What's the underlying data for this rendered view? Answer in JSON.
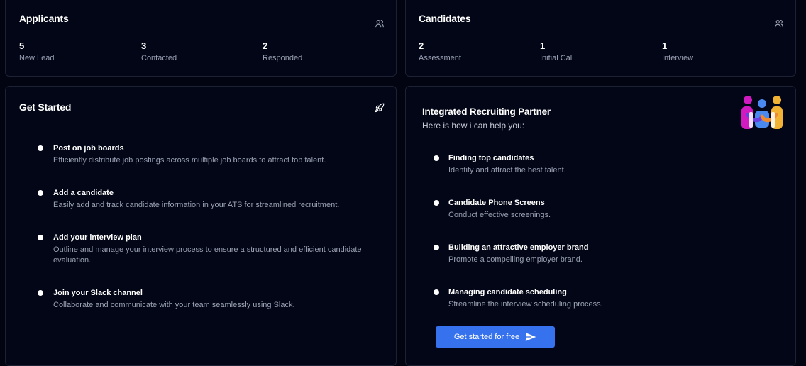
{
  "applicants": {
    "title": "Applicants",
    "icon": "users-icon",
    "stats": [
      {
        "value": "5",
        "label": "New Lead"
      },
      {
        "value": "3",
        "label": "Contacted"
      },
      {
        "value": "2",
        "label": "Responded"
      }
    ]
  },
  "candidates": {
    "title": "Candidates",
    "icon": "users-icon",
    "stats": [
      {
        "value": "2",
        "label": "Assessment"
      },
      {
        "value": "1",
        "label": "Initial Call"
      },
      {
        "value": "1",
        "label": "Interview"
      }
    ]
  },
  "get_started": {
    "title": "Get Started",
    "icon": "rocket-icon",
    "steps": [
      {
        "title": "Post on job boards",
        "desc": "Efficiently distribute job postings across multiple job boards to attract top talent."
      },
      {
        "title": "Add a candidate",
        "desc": "Easily add and track candidate information in your ATS for streamlined recruitment."
      },
      {
        "title": "Add your interview plan",
        "desc": "Outline and manage your interview process to ensure a structured and efficient candidate evaluation."
      },
      {
        "title": "Join your Slack channel",
        "desc": "Collaborate and communicate with your team seamlessly using Slack."
      }
    ]
  },
  "partner": {
    "title": "Integrated Recruiting Partner",
    "subtitle": "Here is how i can help you:",
    "logo": "team-logo-icon",
    "features": [
      {
        "title": "Finding top candidates",
        "desc": "Identify and attract the best talent."
      },
      {
        "title": "Candidate Phone Screens",
        "desc": "Conduct effective screenings."
      },
      {
        "title": "Building an attractive employer brand",
        "desc": "Promote a compelling employer brand."
      },
      {
        "title": "Managing candidate scheduling",
        "desc": "Streamline the interview scheduling process."
      }
    ],
    "cta_label": "Get started for free",
    "cta_icon": "send-icon"
  },
  "colors": {
    "background": "#020412",
    "card_border": "#1c2133",
    "accent": "#3672ee",
    "muted_text": "#9aa1b2"
  }
}
